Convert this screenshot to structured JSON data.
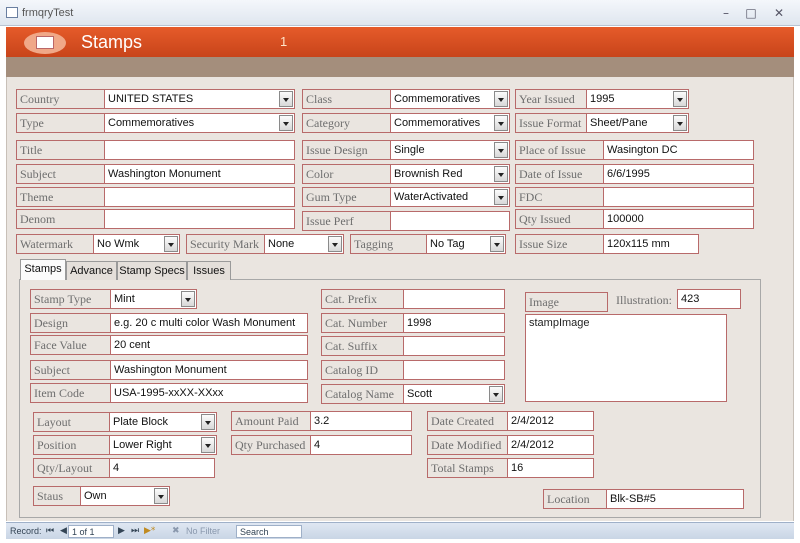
{
  "window": {
    "title": "frmqryTest",
    "controls": [
      "minimize-icon",
      "maximize-icon",
      "close-icon"
    ]
  },
  "header": {
    "title": "Stamps",
    "badge": "1"
  },
  "fields": {
    "country": {
      "label": "Country",
      "value": "UNITED STATES"
    },
    "class": {
      "label": "Class",
      "value": "Commemoratives"
    },
    "year_issued": {
      "label": "Year Issued",
      "value": "1995"
    },
    "type": {
      "label": "Type",
      "value": "Commemoratives"
    },
    "category": {
      "label": "Category",
      "value": "Commemoratives"
    },
    "issue_format": {
      "label": "Issue Format",
      "value": "Sheet/Pane"
    },
    "title": {
      "label": "Title",
      "value": ""
    },
    "issue_design": {
      "label": "Issue Design",
      "value": "Single"
    },
    "place_of_issue": {
      "label": "Place of Issue",
      "value": "Wasington DC"
    },
    "subject": {
      "label": "Subject",
      "value": "Washington Monument"
    },
    "color": {
      "label": "Color",
      "value": "Brownish Red"
    },
    "date_of_issue": {
      "label": "Date of Issue",
      "value": "6/6/1995"
    },
    "theme": {
      "label": "Theme",
      "value": ""
    },
    "gum_type": {
      "label": "Gum Type",
      "value": "WaterActivated"
    },
    "fdc": {
      "label": "FDC",
      "value": ""
    },
    "denom": {
      "label": "Denom",
      "value": ""
    },
    "issue_perf": {
      "label": "Issue Perf",
      "value": ""
    },
    "qty_issued": {
      "label": "Qty Issued",
      "value": "100000"
    },
    "watermark": {
      "label": "Watermark",
      "value": "No Wmk"
    },
    "security_mark": {
      "label": "Security Mark",
      "value": "None"
    },
    "tagging": {
      "label": "Tagging",
      "value": "No Tag"
    },
    "issue_size": {
      "label": "Issue Size",
      "value": "120x115 mm"
    }
  },
  "tabs": [
    {
      "label": "Stamps",
      "active": true
    },
    {
      "label": "Advance",
      "active": false
    },
    {
      "label": "Stamp Specs",
      "active": false
    },
    {
      "label": "Issues",
      "active": false
    }
  ],
  "stamps_tab": {
    "stamp_type": {
      "label": "Stamp Type",
      "value": "Mint"
    },
    "design": {
      "label": "Design",
      "value": "e.g. 20 c  multi color Wash Monument"
    },
    "face_value": {
      "label": "Face Value",
      "value": "20 cent"
    },
    "subject": {
      "label": "Subject",
      "value": "Washington Monument"
    },
    "item_code": {
      "label": "Item Code",
      "value": "USA-1995-xxXX-XXxx"
    },
    "cat_prefix": {
      "label": "Cat. Prefix",
      "value": ""
    },
    "cat_number": {
      "label": "Cat. Number",
      "value": "1998"
    },
    "cat_suffix": {
      "label": "Cat. Suffix",
      "value": ""
    },
    "catalog_id": {
      "label": "Catalog ID",
      "value": ""
    },
    "catalog_name": {
      "label": "Catalog Name",
      "value": "Scott"
    },
    "image": {
      "label": "Image",
      "value": "stampImage"
    },
    "illustration": {
      "label": "Illustration:",
      "value": "423"
    },
    "layout": {
      "label": "Layout",
      "value": "Plate Block"
    },
    "position": {
      "label": "Position",
      "value": "Lower Right"
    },
    "qty_layout": {
      "label": "Qty/Layout",
      "value": "4"
    },
    "amount_paid": {
      "label": "Amount Paid",
      "value": "3.2"
    },
    "qty_purchased": {
      "label": "Qty Purchased",
      "value": "4"
    },
    "date_created": {
      "label": "Date Created",
      "value": "2/4/2012"
    },
    "date_modified": {
      "label": "Date Modified",
      "value": "2/4/2012"
    },
    "total_stamps": {
      "label": "Total Stamps",
      "value": "16"
    },
    "staus": {
      "label": "Staus",
      "value": "Own"
    },
    "location": {
      "label": "Location",
      "value": "Blk-SB#5"
    }
  },
  "statusbar": {
    "record_label": "Record:",
    "record_value": "1 of 1",
    "filter": "No Filter",
    "search": "Search"
  },
  "colors": {
    "header": "#d9501f",
    "stripe": "#a48e7c",
    "form_bg": "#eae5e0",
    "label_border": "#b86a6a"
  }
}
